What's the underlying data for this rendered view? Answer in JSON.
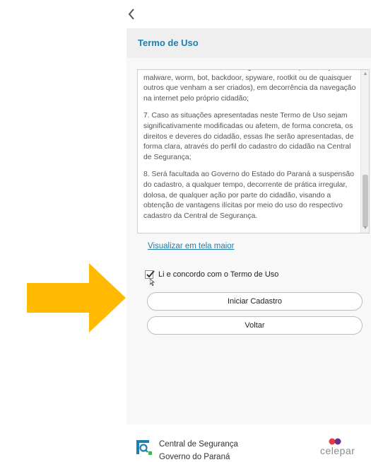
{
  "header": {
    "title": "Termo de Uso",
    "back_icon": "chevron-left-icon"
  },
  "terms": {
    "paragraphs": [
      "cidadão ou de terceiros, de códigos maliciosos (vírus, trojans, malware, worm, bot, backdoor, spyware, rootkit ou de quaisquer outros que venham a ser criados), em decorrência da navegação na internet pelo próprio cidadão;",
      "7. Caso as situações apresentadas neste Termo de Uso sejam significativamente modificadas ou afetem, de forma concreta, os direitos e deveres do cidadão, essas lhe serão apresentadas, de forma clara, através do perfil do cadastro do cidadão na Central de Segurança;",
      "8. Será facultada ao Governo do Estado do Paraná a suspensão do cadastro, a qualquer tempo, decorrente de prática irregular, dolosa, de qualquer ação por parte do cidadão, visando a obtenção de vantagens ilícitas por meio do uso do respectivo cadastro da Central de Segurança."
    ]
  },
  "view_larger_link": "Visualizar em tela maior",
  "agreement": {
    "label": "Li e concordo com o Termo de Uso",
    "checked": true
  },
  "buttons": {
    "start": "Iniciar Cadastro",
    "back": "Voltar"
  },
  "footer": {
    "brand_line1": "Central de Segurança",
    "brand_line2": "Governo do Paraná",
    "partner": "celepar"
  },
  "colors": {
    "accent": "#1f7fae",
    "arrow": "#ffb900",
    "celepar_red": "#e63946",
    "celepar_purple": "#6b2f8a"
  }
}
